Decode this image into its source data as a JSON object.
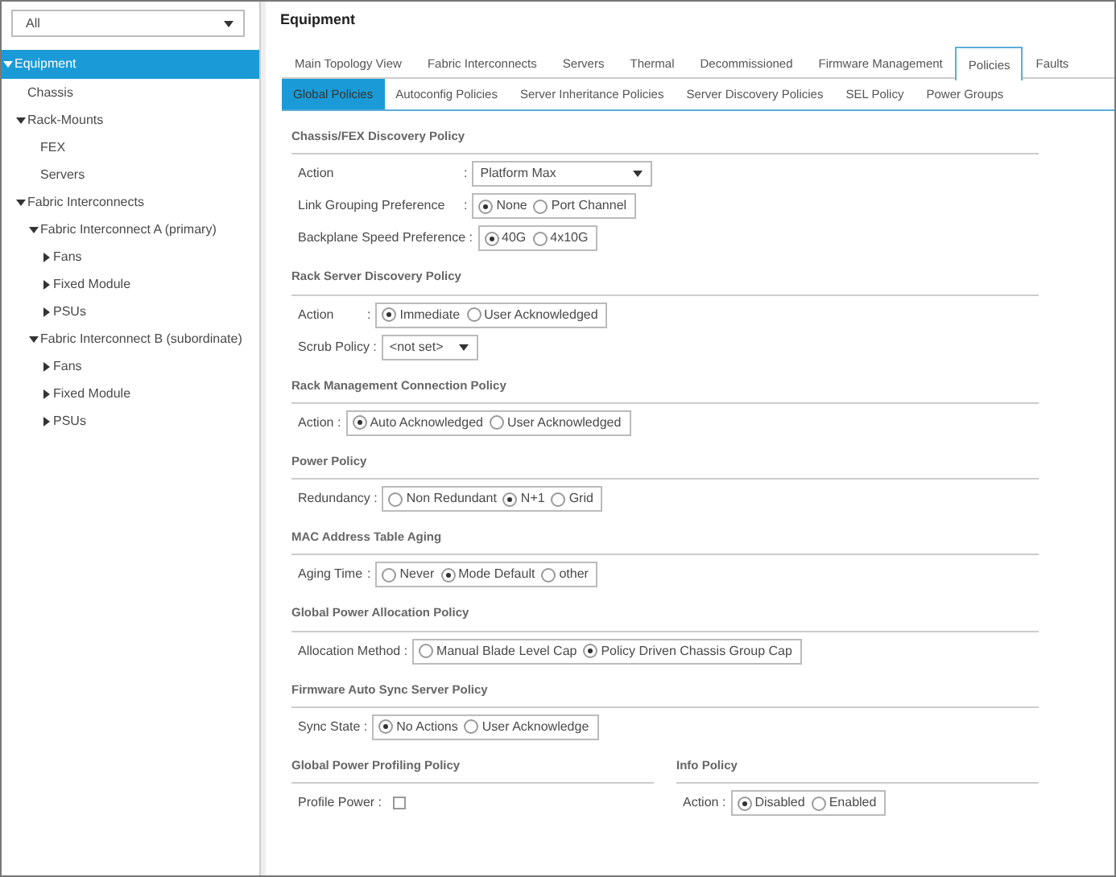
{
  "filter": {
    "value": "All"
  },
  "tree": [
    {
      "label": "Equipment",
      "expanded": true,
      "selected": true,
      "children": [
        {
          "label": "Chassis",
          "selected": false
        },
        {
          "label": "Rack-Mounts",
          "expanded": true,
          "selected": false,
          "children": [
            {
              "label": "FEX",
              "selected": false
            },
            {
              "label": "Servers",
              "selected": false
            }
          ]
        },
        {
          "label": "Fabric Interconnects",
          "expanded": true,
          "selected": false,
          "children": [
            {
              "label": "Fabric Interconnect A (primary)",
              "expanded": true,
              "selected": false,
              "children": [
                {
                  "label": "Fans",
                  "expanded": false,
                  "selected": false
                },
                {
                  "label": "Fixed Module",
                  "expanded": false,
                  "selected": false
                },
                {
                  "label": "PSUs",
                  "expanded": false,
                  "selected": false
                }
              ]
            },
            {
              "label": "Fabric Interconnect B (subordinate)",
              "expanded": true,
              "selected": false,
              "children": [
                {
                  "label": "Fans",
                  "expanded": false,
                  "selected": false
                },
                {
                  "label": "Fixed Module",
                  "expanded": false,
                  "selected": false
                },
                {
                  "label": "PSUs",
                  "expanded": false,
                  "selected": false
                }
              ]
            }
          ]
        }
      ]
    }
  ],
  "title": "Equipment",
  "tabs": [
    {
      "label": "Main Topology View",
      "selected": false
    },
    {
      "label": "Fabric Interconnects",
      "selected": false
    },
    {
      "label": "Servers",
      "selected": false
    },
    {
      "label": "Thermal",
      "selected": false
    },
    {
      "label": "Decommissioned",
      "selected": false
    },
    {
      "label": "Firmware Management",
      "selected": false
    },
    {
      "label": "Policies",
      "selected": true
    },
    {
      "label": "Faults",
      "selected": false
    }
  ],
  "subtabs": [
    {
      "label": "Global Policies",
      "selected": true
    },
    {
      "label": "Autoconfig Policies",
      "selected": false
    },
    {
      "label": "Server Inheritance Policies",
      "selected": false
    },
    {
      "label": "Server Discovery Policies",
      "selected": false
    },
    {
      "label": "SEL Policy",
      "selected": false
    },
    {
      "label": "Power Groups",
      "selected": false
    }
  ],
  "sections": [
    {
      "title": "Chassis/FEX Discovery Policy",
      "fields": [
        {
          "label": "Action",
          "colon": ":",
          "kind": "select",
          "value": "Platform Max"
        },
        {
          "label": "Link Grouping Preference",
          "colon": ":",
          "kind": "radio",
          "options": [
            {
              "label": "None",
              "selected": true
            },
            {
              "label": "Port Channel",
              "selected": false
            }
          ]
        },
        {
          "label": "Backplane Speed Preference :",
          "kind": "radio",
          "options": [
            {
              "label": "40G",
              "selected": true
            },
            {
              "label": "4x10G",
              "selected": false
            }
          ]
        }
      ]
    },
    {
      "title": "Rack Server Discovery Policy",
      "fields": [
        {
          "label": "Action",
          "colon": ":",
          "kind": "radio",
          "options": [
            {
              "label": "Immediate",
              "selected": true
            },
            {
              "label": "User Acknowledged",
              "selected": false
            }
          ]
        },
        {
          "label": "Scrub Policy :",
          "kind": "select",
          "value": "<not set>"
        }
      ]
    },
    {
      "title": "Rack Management Connection Policy",
      "fields": [
        {
          "label": "Action :",
          "kind": "radio",
          "options": [
            {
              "label": "Auto Acknowledged",
              "selected": true
            },
            {
              "label": "User Acknowledged",
              "selected": false
            }
          ]
        }
      ]
    },
    {
      "title": "Power Policy",
      "fields": [
        {
          "label": "Redundancy :",
          "kind": "radio",
          "options": [
            {
              "label": "Non Redundant",
              "selected": false
            },
            {
              "label": "N+1",
              "selected": true
            },
            {
              "label": "Grid",
              "selected": false
            }
          ]
        }
      ]
    },
    {
      "title": "MAC Address Table Aging",
      "fields": [
        {
          "label": "Aging Time",
          "colon": ":",
          "kind": "radio",
          "options": [
            {
              "label": "Never",
              "selected": false
            },
            {
              "label": "Mode Default",
              "selected": true
            },
            {
              "label": "other",
              "selected": false
            }
          ]
        }
      ]
    },
    {
      "title": "Global Power Allocation Policy",
      "fields": [
        {
          "label": "Allocation Method :",
          "kind": "radio",
          "options": [
            {
              "label": "Manual Blade Level Cap",
              "selected": false
            },
            {
              "label": "Policy Driven Chassis Group Cap",
              "selected": true
            }
          ]
        }
      ]
    },
    {
      "title": "Firmware Auto Sync Server Policy",
      "fields": [
        {
          "label": "Sync State :",
          "kind": "radio",
          "options": [
            {
              "label": "No Actions",
              "selected": true
            },
            {
              "label": "User Acknowledge",
              "selected": false
            }
          ]
        }
      ]
    }
  ],
  "paired_sections": [
    {
      "title": "Global Power Profiling Policy",
      "fields": [
        {
          "label": "Profile Power :",
          "kind": "checkbox",
          "checked": false
        }
      ]
    },
    {
      "title": "Info Policy",
      "fields": [
        {
          "label": "Action :",
          "kind": "radio",
          "options": [
            {
              "label": "Disabled",
              "selected": true
            },
            {
              "label": "Enabled",
              "selected": false
            }
          ]
        }
      ]
    }
  ]
}
